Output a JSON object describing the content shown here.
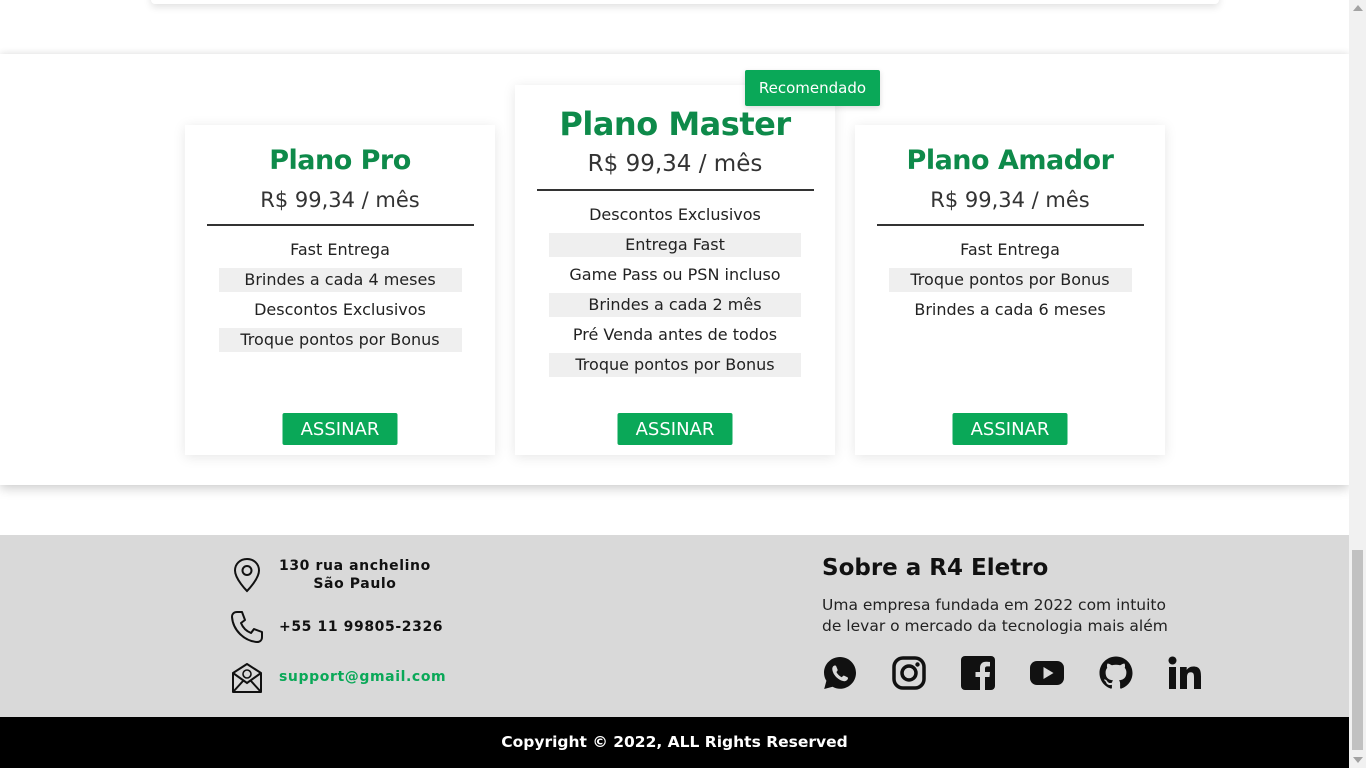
{
  "badge": "Recomendado",
  "plans": [
    {
      "title": "Plano Pro",
      "price": "R$ 99,34 / mês",
      "features": [
        "Fast Entrega",
        "Brindes a cada 4 meses",
        "Descontos Exclusivos",
        "Troque pontos por Bonus"
      ],
      "button": "ASSINAR"
    },
    {
      "title": "Plano Master",
      "price": "R$ 99,34 / mês",
      "features": [
        "Descontos Exclusivos",
        "Entrega Fast",
        "Game Pass ou PSN incluso",
        "Brindes a cada 2 mês",
        "Pré Venda antes de todos",
        "Troque pontos por Bonus"
      ],
      "button": "ASSINAR"
    },
    {
      "title": "Plano Amador",
      "price": "R$ 99,34 / mês",
      "features": [
        "Fast Entrega",
        "Troque pontos por Bonus",
        "Brindes a cada 6 meses"
      ],
      "button": "ASSINAR"
    }
  ],
  "footer": {
    "address_line1": "130 rua anchelino",
    "address_line2": "São Paulo",
    "phone": "+55 11 99805-2326",
    "email": "support@gmail.com",
    "about_title": "Sobre a R4 Eletro",
    "about_text_line1": "Uma empresa fundada em 2022 com intuito",
    "about_text_line2": "de levar o mercado da tecnologia mais além",
    "socials": [
      "whatsapp-icon",
      "instagram-icon",
      "facebook-icon",
      "youtube-icon",
      "github-icon",
      "linkedin-icon"
    ],
    "copyright": "Copyright © 2022, ALL Rights Reserved"
  },
  "colors": {
    "brand_green": "#0aa858",
    "title_green": "#0e8a4a",
    "footer_bg": "#d9d9d9",
    "copyright_bg": "#000000"
  }
}
